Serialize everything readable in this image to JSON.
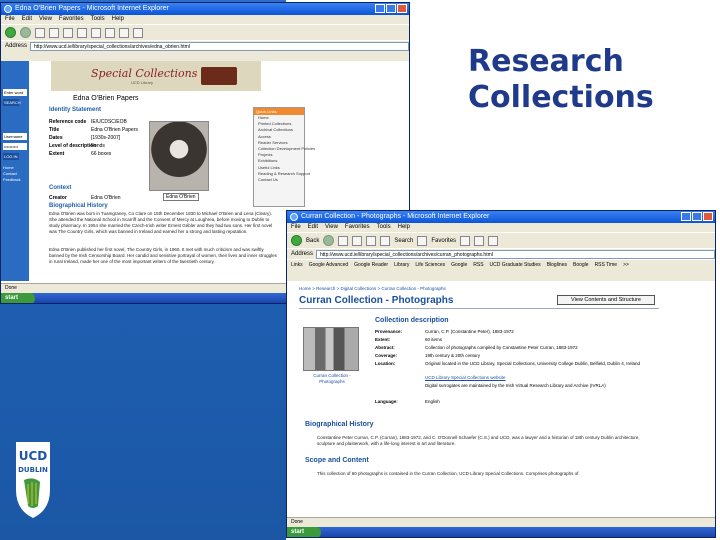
{
  "slide": {
    "title_line1": "Research",
    "title_line2": "Collections",
    "logo_text": "UCD DUBLIN"
  },
  "back_window": {
    "title": "Edna O'Brien Papers - Microsoft Internet Explorer",
    "menu": [
      "File",
      "Edit",
      "View",
      "Favorites",
      "Tools",
      "Help"
    ],
    "address_label": "Address",
    "address": "http://www.ucd.ie/library/special_collections/archives/edna_obrien.html",
    "banner_title": "Special Collections",
    "banner_sub": "UCD Library",
    "nav": {
      "search_value": "Enter word",
      "go_label": "SEARCH",
      "user_label": "Username",
      "password_value": "••••••••••",
      "login_label": "LOG IN",
      "links": [
        "Home",
        "Contact",
        "Feedback"
      ]
    },
    "heading": "Edna O'Brien Papers",
    "identity_heading": "Identity Statement",
    "identity": [
      {
        "label": "Reference code",
        "value": "IE/UCDSC/EOB"
      },
      {
        "label": "Title",
        "value": "Edna O'Brien Papers"
      },
      {
        "label": "Dates",
        "value": "[1930s-2007]"
      },
      {
        "label": "Level of description",
        "value": "Fonds"
      },
      {
        "label": "Extent",
        "value": "66 boxes"
      }
    ],
    "context_heading": "Context",
    "creator_label": "Creator",
    "creator_value": "Edna O'Brien",
    "image_caption": "Edna O'Brien",
    "bio_heading": "Biographical History",
    "quicklinks_title": "Quick Links",
    "quicklinks": [
      "Home",
      "Printed Collections",
      "Archival Collections",
      "Access",
      "Reader Services",
      "Collection Development Policies",
      "Projects",
      "Exhibitions",
      "Useful Links",
      "Reading & Research Support",
      "Contact Us"
    ],
    "bio_para1": "Edna O'Brien was born in Tuamgraney, Co Clare on 15th December 1930 to Michael O'Brien and Lena (Cleary). She attended the National School in Scarriff and the Convent of Mercy at Loughrea, before moving to Dublin to study pharmacy. In 1954 she married the Czech-Irish writer Ernest Gébler and they had two sons. Her first novel was The Country Girls, which was banned in Ireland and earned her a strong and lasting reputation.",
    "bio_para2": "Edna O'Brien published her first novel, The Country Girls, in 1960. It met with much criticism and was swiftly banned by the Irish Censorship Board. Her candid and sensitive portrayal of women, their lives and inner struggles in rural Ireland, made her one of the most important writers of the twentieth century.",
    "status": "Done",
    "taskbar_start": "start"
  },
  "front_window": {
    "title": "Curran Collection - Photographs - Microsoft Internet Explorer",
    "menu": [
      "File",
      "Edit",
      "View",
      "Favorites",
      "Tools",
      "Help"
    ],
    "back_label": "Back",
    "search_label": "Search",
    "favorites_label": "Favorites",
    "address_label": "Address",
    "address": "http://www.ucd.ie/library/special_collections/archives/curran_photographs.html",
    "links": [
      "Links",
      "Google Advanced",
      "Google Reader",
      "Library",
      "Life Sciences",
      "Google",
      "RSS",
      "UCD Graduate Studies",
      "Bloglines",
      "Boogle",
      "RSS Time",
      ">>"
    ],
    "breadcrumb": "Home > Research > Digital Collections > Curran Collection - Photographs",
    "page_title": "Curran Collection - Photographs",
    "view_button": "View Contents and Structure",
    "photo_caption": "Curran Collection - Photographs",
    "cd_heading": "Collection description",
    "fields": [
      {
        "label": "Provenance:",
        "value": "Curran, C.P. (Constantine Peter), 1883-1972"
      },
      {
        "label": "Extent:",
        "value": "60 items"
      },
      {
        "label": "Abstract:",
        "value": "Collection of photographs compiled by Constantine Peter Curran, 1883-1972"
      },
      {
        "label": "Coverage:",
        "value": "19th century & 20th century"
      },
      {
        "label": "Location:",
        "value": "Original located in the UCD Library, Special Collections, University College Dublin, Belfield, Dublin 4, Ireland"
      },
      {
        "label": "",
        "value": "Digital surrogates are maintained by the Irish Virtual Research Library and Archive (IVRLA)"
      },
      {
        "label": "Language:",
        "value": "English"
      }
    ],
    "location_link": "UCD Library Special Collections website",
    "bio_heading": "Biographical History",
    "bio_text": "Constantine Peter Curran, C.P. (Curran), 1883-1972, and C. O'Donnell Schaefer (C.S.) and UCD, was a lawyer and a historian of 18th century Dublin architecture, sculpture and plasterwork, with a life-long interest in art and literature.",
    "scope_heading": "Scope and Content",
    "scope_text": "This collection of 60 photographs is contained in the Curran Collection, UCD Library Special Collections. Comprises photographs of",
    "status": "Done",
    "taskbar_start": "start"
  }
}
